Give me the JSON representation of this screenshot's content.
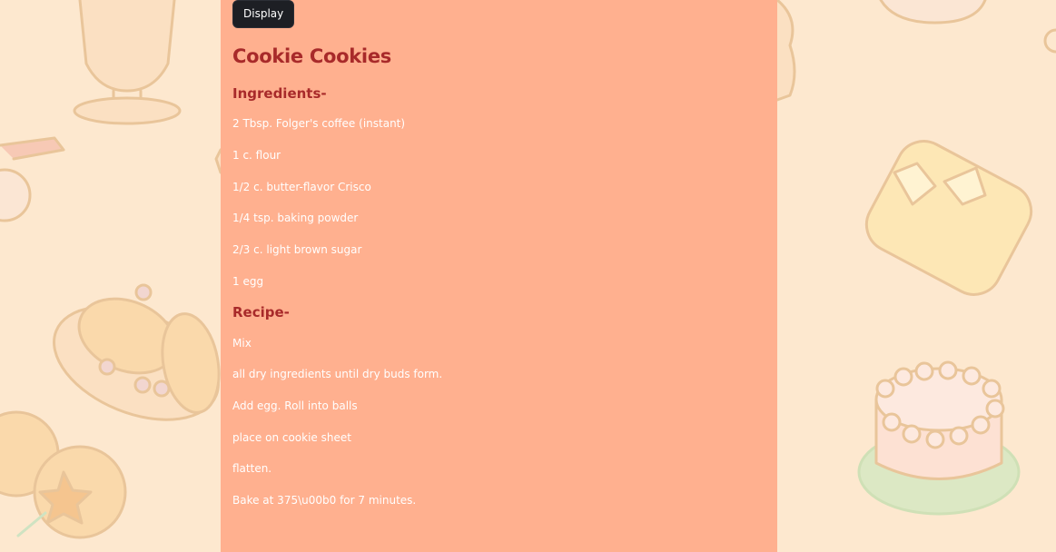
{
  "toolbar": {
    "display_label": "Display"
  },
  "recipe": {
    "title": "Cookie Cookies",
    "ingredients_heading": "Ingredients-",
    "ingredients": [
      "2 Tbsp. Folger's coffee (instant)",
      "1 c. flour",
      "1/2 c. butter-flavor Crisco",
      "1/4 tsp. baking powder",
      "2/3 c. light brown sugar",
      "1 egg"
    ],
    "recipe_heading": "Recipe-",
    "steps": [
      "Mix",
      "all dry ingredients until dry buds form.",
      "Add egg. Roll into balls",
      "place on cookie sheet",
      "flatten.",
      "Bake at 375\\u00b0 for 7 minutes."
    ]
  },
  "colors": {
    "page_background": "#fde8cf",
    "panel_background": "#ffb08f",
    "heading_color": "#a82a2a",
    "button_background": "#1d1f24"
  },
  "background_icons": [
    "parfait-glass-icon",
    "straw-cup-icon",
    "cinnamon-roll-plate-icon",
    "cookies-icon",
    "pudding-icon",
    "cake-icon"
  ]
}
